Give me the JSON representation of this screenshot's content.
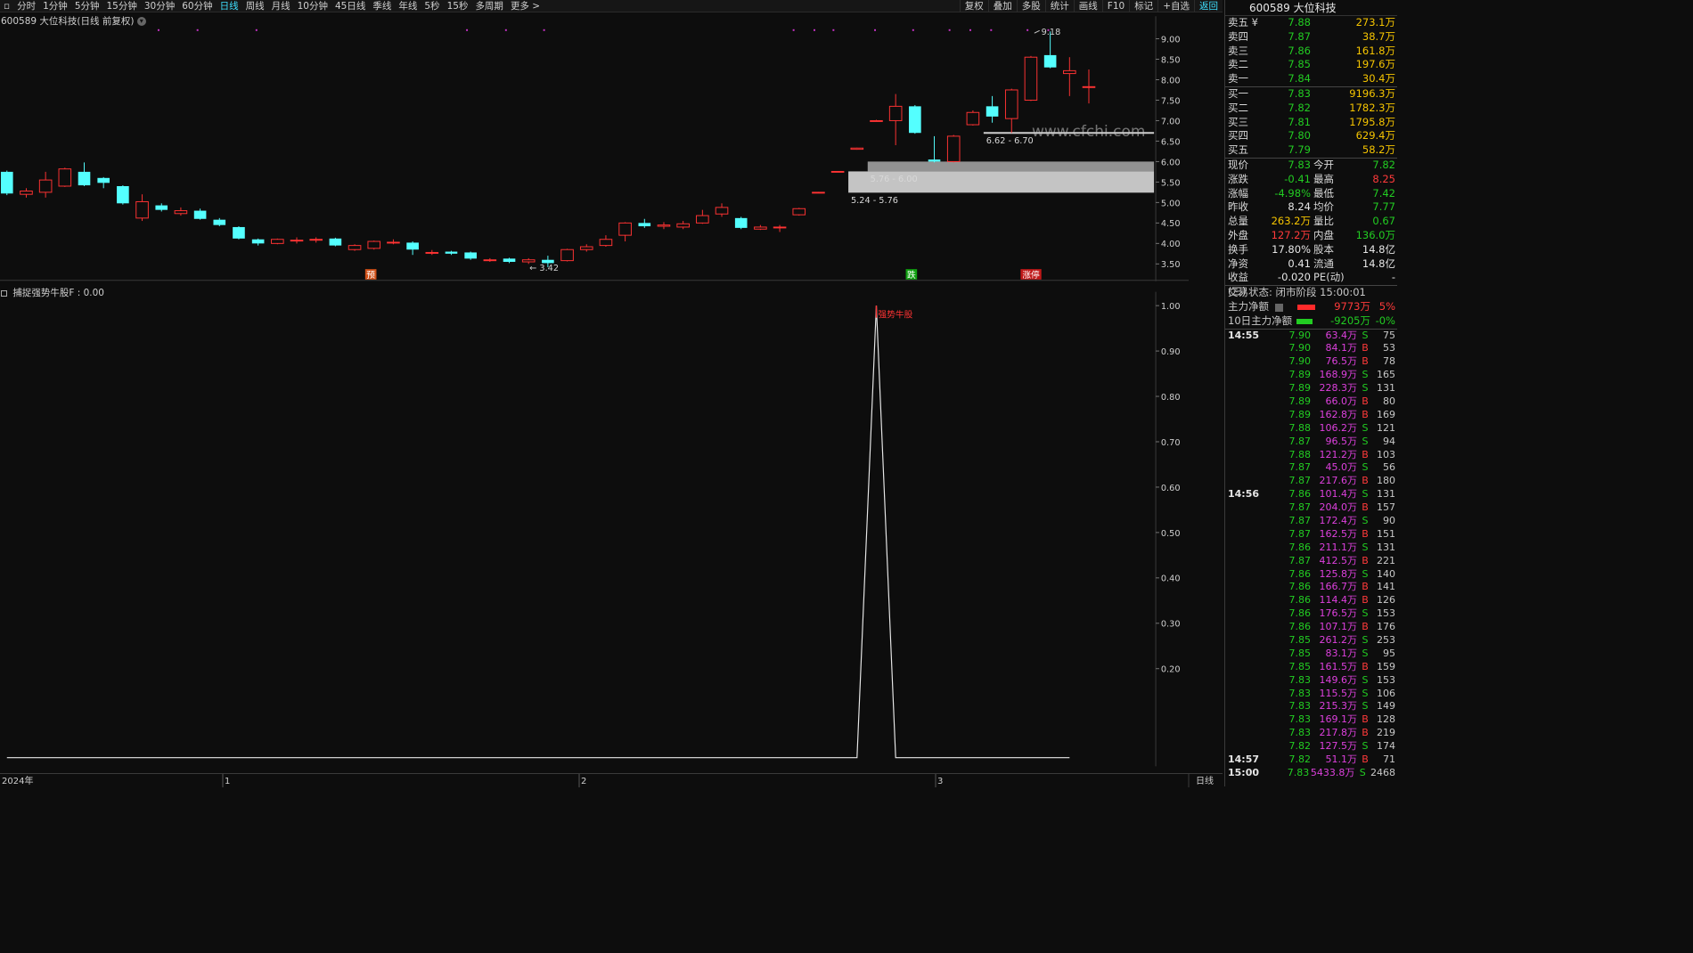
{
  "toolbar": {
    "periods": [
      "分时",
      "1分钟",
      "5分钟",
      "15分钟",
      "30分钟",
      "60分钟",
      "日线",
      "周线",
      "月线",
      "10分钟",
      "45日线",
      "季线",
      "年线",
      "5秒",
      "15秒",
      "多周期",
      "更多 >"
    ],
    "active": "日线",
    "actions": [
      "复权",
      "叠加",
      "多股",
      "统计",
      "画线",
      "F10",
      "标记",
      "+自选",
      "返回"
    ]
  },
  "chart": {
    "stock_title": "600589 大位科技(日线 前复权)",
    "indicator_title": "捕捉强势牛股F : 0.00",
    "watermark": "www.cfchi.com",
    "price_axis": [
      "9.00",
      "8.50",
      "8.00",
      "7.50",
      "7.00",
      "6.50",
      "6.00",
      "5.50",
      "5.00",
      "4.50",
      "4.00",
      "3.50"
    ],
    "ind_axis": [
      "1.00",
      "0.90",
      "0.80",
      "0.70",
      "0.60",
      "0.50",
      "0.40",
      "0.30",
      "0.20"
    ],
    "x_labels": [
      "2024年",
      "1",
      "2",
      "3"
    ],
    "period_label": "日线",
    "high_label": "9.18",
    "low_label": "3.42",
    "zones": [
      "5.24 - 5.76",
      "5.76 - 6.00",
      "6.62 - 6.70"
    ],
    "markers": [
      "预",
      "跌",
      "涨停"
    ],
    "signal_label": "强势牛股"
  },
  "panel": {
    "title": "600589 大位科技",
    "asks": [
      {
        "label": "卖五 ¥",
        "price": "7.88",
        "vol": "273.1万"
      },
      {
        "label": "卖四",
        "price": "7.87",
        "vol": "38.7万"
      },
      {
        "label": "卖三",
        "price": "7.86",
        "vol": "161.8万"
      },
      {
        "label": "卖二",
        "price": "7.85",
        "vol": "197.6万"
      },
      {
        "label": "卖一",
        "price": "7.84",
        "vol": "30.4万"
      }
    ],
    "bids": [
      {
        "label": "买一",
        "price": "7.83",
        "vol": "9196.3万"
      },
      {
        "label": "买二",
        "price": "7.82",
        "vol": "1782.3万"
      },
      {
        "label": "买三",
        "price": "7.81",
        "vol": "1795.8万"
      },
      {
        "label": "买四",
        "price": "7.80",
        "vol": "629.4万"
      },
      {
        "label": "买五",
        "price": "7.79",
        "vol": "58.2万"
      }
    ],
    "stats": [
      {
        "k1": "现价",
        "v1": "7.83",
        "c1": "green",
        "k2": "今开",
        "v2": "7.82",
        "c2": "green"
      },
      {
        "k1": "涨跌",
        "v1": "-0.41",
        "c1": "green",
        "k2": "最高",
        "v2": "8.25",
        "c2": "red"
      },
      {
        "k1": "涨幅",
        "v1": "-4.98%",
        "c1": "green",
        "k2": "最低",
        "v2": "7.42",
        "c2": "green"
      },
      {
        "k1": "昨收",
        "v1": "8.24",
        "c1": "white",
        "k2": "均价",
        "v2": "7.77",
        "c2": "green"
      },
      {
        "k1": "总量",
        "v1": "263.2万",
        "c1": "yellow",
        "k2": "量比",
        "v2": "0.67",
        "c2": "green"
      },
      {
        "k1": "外盘",
        "v1": "127.2万",
        "c1": "red",
        "k2": "内盘",
        "v2": "136.0万",
        "c2": "green"
      },
      {
        "k1": "换手",
        "v1": "17.80%",
        "c1": "white",
        "k2": "股本",
        "v2": "14.8亿",
        "c2": "white"
      },
      {
        "k1": "净资",
        "v1": "0.41",
        "c1": "white",
        "k2": "流通",
        "v2": "14.8亿",
        "c2": "white"
      },
      {
        "k1": "收益(三)",
        "v1": "-0.020",
        "c1": "white",
        "k2": "PE(动)",
        "v2": "-",
        "c2": "white"
      }
    ],
    "trade_status": "交易状态: 闭市阶段 15:00:01",
    "main_net_label": "主力净额",
    "main_net_value": "9773万",
    "main_net_pct": "5%",
    "ten_day_label": "10日主力净额",
    "ten_day_value": "-9205万",
    "ten_day_pct": "-0%",
    "ticks": [
      {
        "time": "14:55",
        "price": "7.90",
        "vol": "63.4万",
        "dir": "S",
        "n": "75"
      },
      {
        "time": "",
        "price": "7.90",
        "vol": "84.1万",
        "dir": "B",
        "n": "53"
      },
      {
        "time": "",
        "price": "7.90",
        "vol": "76.5万",
        "dir": "B",
        "n": "78"
      },
      {
        "time": "",
        "price": "7.89",
        "vol": "168.9万",
        "dir": "S",
        "n": "165"
      },
      {
        "time": "",
        "price": "7.89",
        "vol": "228.3万",
        "dir": "S",
        "n": "131"
      },
      {
        "time": "",
        "price": "7.89",
        "vol": "66.0万",
        "dir": "B",
        "n": "80"
      },
      {
        "time": "",
        "price": "7.89",
        "vol": "162.8万",
        "dir": "B",
        "n": "169"
      },
      {
        "time": "",
        "price": "7.88",
        "vol": "106.2万",
        "dir": "S",
        "n": "121"
      },
      {
        "time": "",
        "price": "7.87",
        "vol": "96.5万",
        "dir": "S",
        "n": "94"
      },
      {
        "time": "",
        "price": "7.88",
        "vol": "121.2万",
        "dir": "B",
        "n": "103"
      },
      {
        "time": "",
        "price": "7.87",
        "vol": "45.0万",
        "dir": "S",
        "n": "56"
      },
      {
        "time": "",
        "price": "7.87",
        "vol": "217.6万",
        "dir": "B",
        "n": "180"
      },
      {
        "time": "14:56",
        "price": "7.86",
        "vol": "101.4万",
        "dir": "S",
        "n": "131"
      },
      {
        "time": "",
        "price": "7.87",
        "vol": "204.0万",
        "dir": "B",
        "n": "157"
      },
      {
        "time": "",
        "price": "7.87",
        "vol": "172.4万",
        "dir": "S",
        "n": "90"
      },
      {
        "time": "",
        "price": "7.87",
        "vol": "162.5万",
        "dir": "B",
        "n": "151"
      },
      {
        "time": "",
        "price": "7.86",
        "vol": "211.1万",
        "dir": "S",
        "n": "131"
      },
      {
        "time": "",
        "price": "7.87",
        "vol": "412.5万",
        "dir": "B",
        "n": "221"
      },
      {
        "time": "",
        "price": "7.86",
        "vol": "125.8万",
        "dir": "S",
        "n": "140"
      },
      {
        "time": "",
        "price": "7.86",
        "vol": "166.7万",
        "dir": "B",
        "n": "141"
      },
      {
        "time": "",
        "price": "7.86",
        "vol": "114.4万",
        "dir": "B",
        "n": "126"
      },
      {
        "time": "",
        "price": "7.86",
        "vol": "176.5万",
        "dir": "S",
        "n": "153"
      },
      {
        "time": "",
        "price": "7.86",
        "vol": "107.1万",
        "dir": "B",
        "n": "176"
      },
      {
        "time": "",
        "price": "7.85",
        "vol": "261.2万",
        "dir": "S",
        "n": "253"
      },
      {
        "time": "",
        "price": "7.85",
        "vol": "83.1万",
        "dir": "S",
        "n": "95"
      },
      {
        "time": "",
        "price": "7.85",
        "vol": "161.5万",
        "dir": "B",
        "n": "159"
      },
      {
        "time": "",
        "price": "7.83",
        "vol": "149.6万",
        "dir": "S",
        "n": "153"
      },
      {
        "time": "",
        "price": "7.83",
        "vol": "115.5万",
        "dir": "S",
        "n": "106"
      },
      {
        "time": "",
        "price": "7.83",
        "vol": "215.3万",
        "dir": "S",
        "n": "149"
      },
      {
        "time": "",
        "price": "7.83",
        "vol": "169.1万",
        "dir": "B",
        "n": "128"
      },
      {
        "time": "",
        "price": "7.83",
        "vol": "217.8万",
        "dir": "B",
        "n": "219"
      },
      {
        "time": "",
        "price": "7.82",
        "vol": "127.5万",
        "dir": "S",
        "n": "174"
      },
      {
        "time": "14:57",
        "price": "7.82",
        "vol": "51.1万",
        "dir": "B",
        "n": "71"
      },
      {
        "time": "15:00",
        "price": "7.83",
        "vol": "5433.8万",
        "dir": "S",
        "n": "2468"
      }
    ]
  },
  "chart_data": {
    "type": "candlestick",
    "title": "",
    "ylim": [
      3.3,
      9.3
    ],
    "candles": [
      {
        "o": 5.75,
        "c": 5.22,
        "h": 5.78,
        "l": 5.18
      },
      {
        "o": 5.2,
        "c": 5.28,
        "h": 5.35,
        "l": 5.12
      },
      {
        "o": 5.25,
        "c": 5.55,
        "h": 5.75,
        "l": 5.12
      },
      {
        "o": 5.4,
        "c": 5.82,
        "h": 5.85,
        "l": 5.38
      },
      {
        "o": 5.75,
        "c": 5.42,
        "h": 5.98,
        "l": 5.4
      },
      {
        "o": 5.6,
        "c": 5.48,
        "h": 5.62,
        "l": 5.35
      },
      {
        "o": 5.4,
        "c": 4.98,
        "h": 5.42,
        "l": 4.95
      },
      {
        "o": 4.62,
        "c": 5.02,
        "h": 5.2,
        "l": 4.55
      },
      {
        "o": 4.93,
        "c": 4.82,
        "h": 4.98,
        "l": 4.78
      },
      {
        "o": 4.73,
        "c": 4.8,
        "h": 4.88,
        "l": 4.68
      },
      {
        "o": 4.8,
        "c": 4.6,
        "h": 4.85,
        "l": 4.58
      },
      {
        "o": 4.58,
        "c": 4.45,
        "h": 4.62,
        "l": 4.42
      },
      {
        "o": 4.4,
        "c": 4.12,
        "h": 4.42,
        "l": 4.1
      },
      {
        "o": 4.1,
        "c": 4.0,
        "h": 4.12,
        "l": 3.95
      },
      {
        "o": 4.0,
        "c": 4.1,
        "h": 4.12,
        "l": 3.98
      },
      {
        "o": 4.08,
        "c": 4.08,
        "h": 4.15,
        "l": 4.0
      },
      {
        "o": 4.08,
        "c": 4.1,
        "h": 4.15,
        "l": 4.02
      },
      {
        "o": 4.12,
        "c": 3.95,
        "h": 4.14,
        "l": 3.93
      },
      {
        "o": 3.85,
        "c": 3.95,
        "h": 3.98,
        "l": 3.82
      },
      {
        "o": 3.88,
        "c": 4.05,
        "h": 4.07,
        "l": 3.85
      },
      {
        "o": 4.02,
        "c": 4.03,
        "h": 4.1,
        "l": 3.98
      },
      {
        "o": 4.02,
        "c": 3.85,
        "h": 4.05,
        "l": 3.72
      },
      {
        "o": 3.78,
        "c": 3.78,
        "h": 3.84,
        "l": 3.72
      },
      {
        "o": 3.8,
        "c": 3.75,
        "h": 3.82,
        "l": 3.72
      },
      {
        "o": 3.78,
        "c": 3.63,
        "h": 3.8,
        "l": 3.6
      },
      {
        "o": 3.6,
        "c": 3.6,
        "h": 3.64,
        "l": 3.55
      },
      {
        "o": 3.63,
        "c": 3.55,
        "h": 3.65,
        "l": 3.52
      },
      {
        "o": 3.55,
        "c": 3.6,
        "h": 3.64,
        "l": 3.5
      },
      {
        "o": 3.6,
        "c": 3.52,
        "h": 3.7,
        "l": 3.42
      },
      {
        "o": 3.58,
        "c": 3.85,
        "h": 3.87,
        "l": 3.56
      },
      {
        "o": 3.85,
        "c": 3.92,
        "h": 3.98,
        "l": 3.8
      },
      {
        "o": 3.95,
        "c": 4.1,
        "h": 4.2,
        "l": 3.92
      },
      {
        "o": 4.2,
        "c": 4.5,
        "h": 4.52,
        "l": 4.05
      },
      {
        "o": 4.5,
        "c": 4.42,
        "h": 4.6,
        "l": 4.38
      },
      {
        "o": 4.42,
        "c": 4.45,
        "h": 4.52,
        "l": 4.35
      },
      {
        "o": 4.4,
        "c": 4.48,
        "h": 4.55,
        "l": 4.35
      },
      {
        "o": 4.5,
        "c": 4.68,
        "h": 4.82,
        "l": 4.48
      },
      {
        "o": 4.72,
        "c": 4.88,
        "h": 4.98,
        "l": 4.65
      },
      {
        "o": 4.62,
        "c": 4.38,
        "h": 4.65,
        "l": 4.35
      },
      {
        "o": 4.35,
        "c": 4.4,
        "h": 4.45,
        "l": 4.33
      },
      {
        "o": 4.4,
        "c": 4.4,
        "h": 4.45,
        "l": 4.28
      },
      {
        "o": 4.7,
        "c": 4.85,
        "h": 4.87,
        "l": 4.68
      },
      {
        "o": 5.25,
        "c": 5.25,
        "h": 5.26,
        "l": 5.24
      },
      {
        "o": 5.76,
        "c": 5.76,
        "h": 5.77,
        "l": 5.75
      },
      {
        "o": 6.3,
        "c": 6.33,
        "h": 6.34,
        "l": 6.29
      },
      {
        "o": 7.0,
        "c": 7.0,
        "h": 7.02,
        "l": 6.98
      },
      {
        "o": 7.0,
        "c": 7.35,
        "h": 7.65,
        "l": 6.4
      },
      {
        "o": 7.35,
        "c": 6.7,
        "h": 7.38,
        "l": 6.68
      },
      {
        "o": 6.05,
        "c": 6.0,
        "h": 6.62,
        "l": 5.98
      },
      {
        "o": 6.0,
        "c": 6.62,
        "h": 6.65,
        "l": 5.98
      },
      {
        "o": 6.9,
        "c": 7.2,
        "h": 7.25,
        "l": 6.88
      },
      {
        "o": 7.35,
        "c": 7.1,
        "h": 7.6,
        "l": 6.95
      },
      {
        "o": 7.05,
        "c": 7.75,
        "h": 7.78,
        "l": 6.7
      },
      {
        "o": 7.5,
        "c": 8.55,
        "h": 8.58,
        "l": 7.48
      },
      {
        "o": 8.6,
        "c": 8.3,
        "h": 9.18,
        "l": 8.28
      },
      {
        "o": 8.15,
        "c": 8.22,
        "h": 8.55,
        "l": 7.6
      },
      {
        "o": 7.83,
        "c": 7.83,
        "h": 8.25,
        "l": 7.42
      }
    ],
    "zones": [
      {
        "label": "5.24 - 5.76",
        "lo": 5.24,
        "hi": 5.76,
        "from_index": 44
      },
      {
        "label": "5.76 - 6.00",
        "lo": 5.76,
        "hi": 6.0,
        "from_index": 45
      },
      {
        "label": "6.62 - 6.70",
        "lo": 6.62,
        "hi": 6.7,
        "from_index": 51
      }
    ],
    "indicator": {
      "name": "捕捉强势牛股F",
      "ylim": [
        0,
        1
      ],
      "values": [
        0,
        0,
        0,
        0,
        0,
        0,
        0,
        0,
        0,
        0,
        0,
        0,
        0,
        0,
        0,
        0,
        0,
        0,
        0,
        0,
        0,
        0,
        0,
        0,
        0,
        0,
        0,
        0,
        0,
        0,
        0,
        0,
        0,
        0,
        0,
        0,
        0,
        0,
        0,
        0,
        0,
        0,
        0,
        0,
        0,
        1,
        0,
        0,
        0,
        0,
        0,
        0,
        0,
        0,
        0,
        0
      ]
    }
  }
}
